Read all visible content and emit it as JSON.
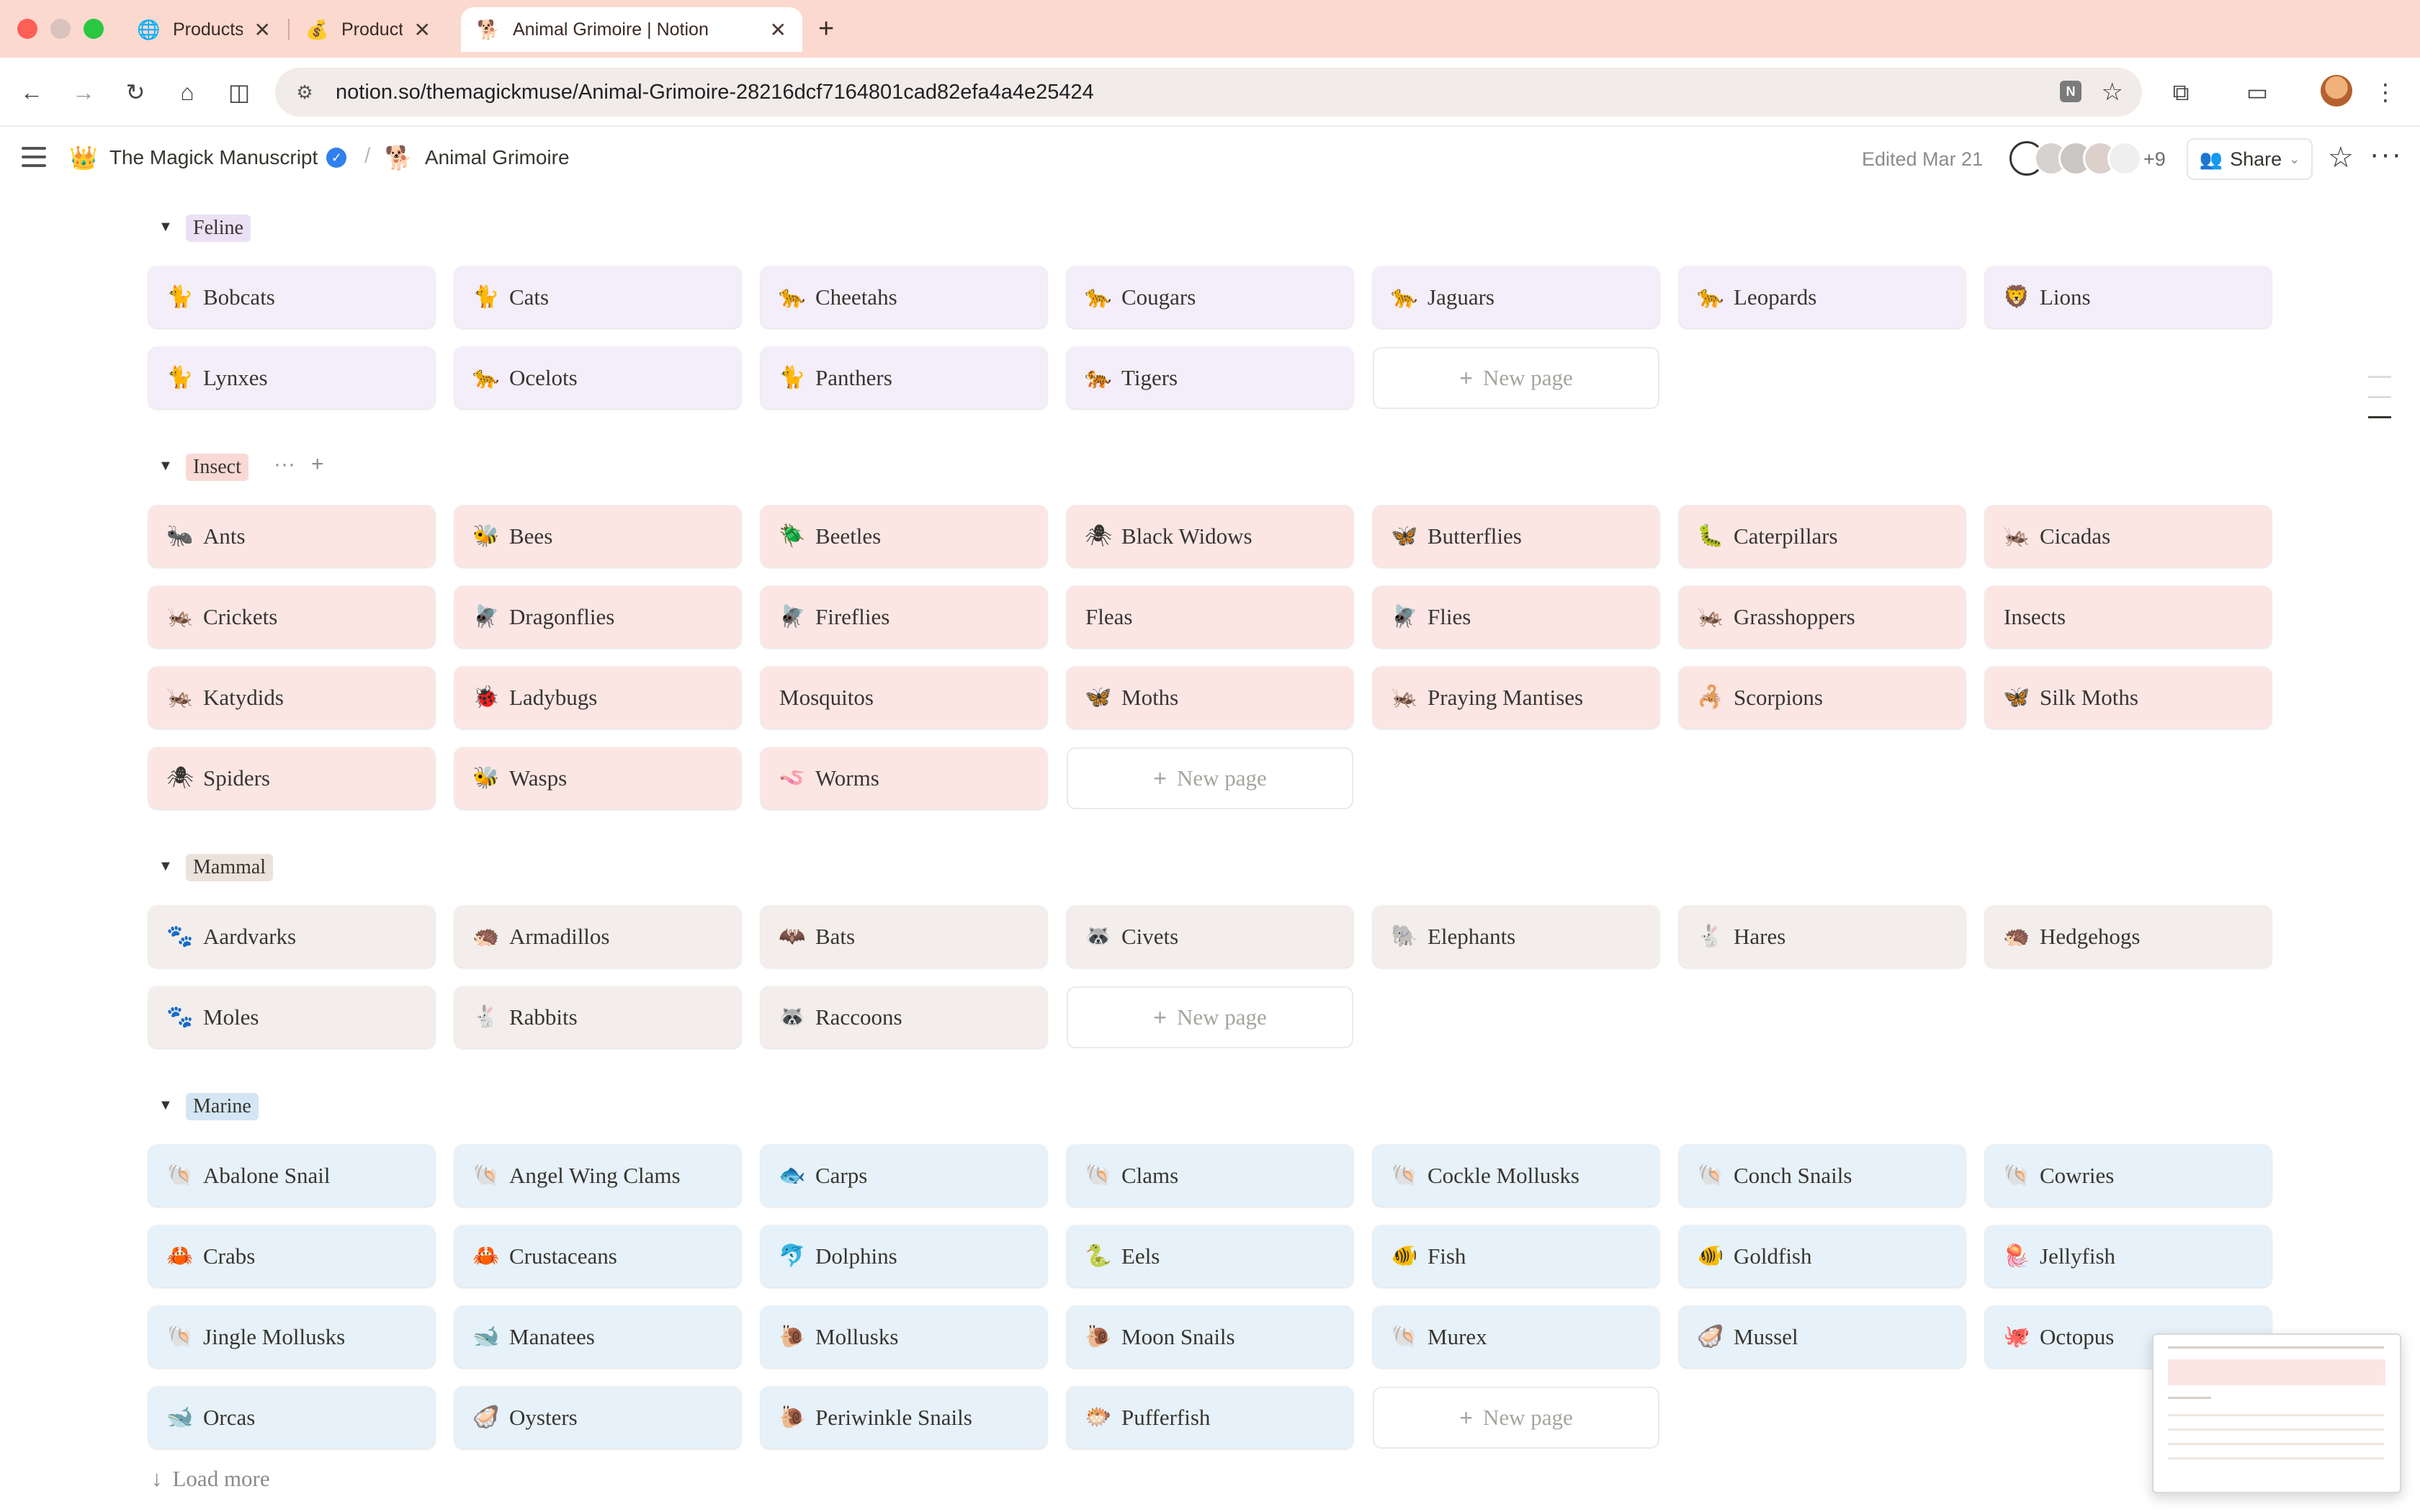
{
  "browser": {
    "tabs": [
      {
        "title": "Products",
        "icon": "globe-icon",
        "glyph": "🌐"
      },
      {
        "title": "Product I",
        "icon": "money-bag-icon",
        "glyph": "💰"
      },
      {
        "title": "Animal Grimoire | Notion",
        "icon": "dog-icon",
        "glyph": "🐕"
      }
    ],
    "url": "notion.so/themagickmuse/Animal-Grimoire-28216dcf7164801cad82efa4a4e25424"
  },
  "topbar": {
    "workspace": "The Magick Manuscript",
    "workspace_glyph": "👑",
    "page": "Animal Grimoire",
    "page_glyph": "🐕",
    "edited": "Edited Mar 21",
    "more_count": "+9",
    "share_label": "Share"
  },
  "groups": {
    "feline": {
      "label": "Feline",
      "cards": [
        {
          "name": "Bobcats",
          "glyph": "🐈"
        },
        {
          "name": "Cats",
          "glyph": "🐈"
        },
        {
          "name": "Cheetahs",
          "glyph": "🐆"
        },
        {
          "name": "Cougars",
          "glyph": "🐆"
        },
        {
          "name": "Jaguars",
          "glyph": "🐆"
        },
        {
          "name": "Leopards",
          "glyph": "🐆"
        },
        {
          "name": "Lions",
          "glyph": "🦁"
        },
        {
          "name": "Lynxes",
          "glyph": "🐈"
        },
        {
          "name": "Ocelots",
          "glyph": "🐆"
        },
        {
          "name": "Panthers",
          "glyph": "🐈"
        },
        {
          "name": "Tigers",
          "glyph": "🐅"
        }
      ]
    },
    "insect": {
      "label": "Insect",
      "cards": [
        {
          "name": "Ants",
          "glyph": "🐜"
        },
        {
          "name": "Bees",
          "glyph": "🐝"
        },
        {
          "name": "Beetles",
          "glyph": "🪲"
        },
        {
          "name": "Black Widows",
          "glyph": "🕷"
        },
        {
          "name": "Butterflies",
          "glyph": "🦋"
        },
        {
          "name": "Caterpillars",
          "glyph": "🐛"
        },
        {
          "name": "Cicadas",
          "glyph": "🦗"
        },
        {
          "name": "Crickets",
          "glyph": "🦗"
        },
        {
          "name": "Dragonflies",
          "glyph": "🪰"
        },
        {
          "name": "Fireflies",
          "glyph": "🪰"
        },
        {
          "name": "Fleas",
          "glyph": ""
        },
        {
          "name": "Flies",
          "glyph": "🪰"
        },
        {
          "name": "Grasshoppers",
          "glyph": "🦗"
        },
        {
          "name": "Insects",
          "glyph": ""
        },
        {
          "name": "Katydids",
          "glyph": "🦗"
        },
        {
          "name": "Ladybugs",
          "glyph": "🐞"
        },
        {
          "name": "Mosquitos",
          "glyph": ""
        },
        {
          "name": "Moths",
          "glyph": "🦋"
        },
        {
          "name": "Praying Mantises",
          "glyph": "🦗"
        },
        {
          "name": "Scorpions",
          "glyph": "🦂"
        },
        {
          "name": "Silk Moths",
          "glyph": "🦋"
        },
        {
          "name": "Spiders",
          "glyph": "🕷"
        },
        {
          "name": "Wasps",
          "glyph": "🐝"
        },
        {
          "name": "Worms",
          "glyph": "🪱"
        }
      ]
    },
    "mammal": {
      "label": "Mammal",
      "cards": [
        {
          "name": "Aardvarks",
          "glyph": "🐾"
        },
        {
          "name": "Armadillos",
          "glyph": "🦔"
        },
        {
          "name": "Bats",
          "glyph": "🦇"
        },
        {
          "name": "Civets",
          "glyph": "🦝"
        },
        {
          "name": "Elephants",
          "glyph": "🐘"
        },
        {
          "name": "Hares",
          "glyph": "🐇"
        },
        {
          "name": "Hedgehogs",
          "glyph": "🦔"
        },
        {
          "name": "Moles",
          "glyph": "🐾"
        },
        {
          "name": "Rabbits",
          "glyph": "🐇"
        },
        {
          "name": "Raccoons",
          "glyph": "🦝"
        }
      ]
    },
    "marine": {
      "label": "Marine",
      "cards": [
        {
          "name": "Abalone Snail",
          "glyph": "🐚"
        },
        {
          "name": "Angel Wing Clams",
          "glyph": "🐚"
        },
        {
          "name": "Carps",
          "glyph": "🐟"
        },
        {
          "name": "Clams",
          "glyph": "🐚"
        },
        {
          "name": "Cockle Mollusks",
          "glyph": "🐚"
        },
        {
          "name": "Conch Snails",
          "glyph": "🐚"
        },
        {
          "name": "Cowries",
          "glyph": "🐚"
        },
        {
          "name": "Crabs",
          "glyph": "🦀"
        },
        {
          "name": "Crustaceans",
          "glyph": "🦀"
        },
        {
          "name": "Dolphins",
          "glyph": "🐬"
        },
        {
          "name": "Eels",
          "glyph": "🐍"
        },
        {
          "name": "Fish",
          "glyph": "🐠"
        },
        {
          "name": "Goldfish",
          "glyph": "🐠"
        },
        {
          "name": "Jellyfish",
          "glyph": "🪼"
        },
        {
          "name": "Jingle Mollusks",
          "glyph": "🐚"
        },
        {
          "name": "Manatees",
          "glyph": "🐋"
        },
        {
          "name": "Mollusks",
          "glyph": "🐌"
        },
        {
          "name": "Moon Snails",
          "glyph": "🐌"
        },
        {
          "name": "Murex",
          "glyph": "🐚"
        },
        {
          "name": "Mussel",
          "glyph": "🦪"
        },
        {
          "name": "Octopus",
          "glyph": "🐙"
        },
        {
          "name": "Orcas",
          "glyph": "🐋"
        },
        {
          "name": "Oysters",
          "glyph": "🦪"
        },
        {
          "name": "Periwinkle Snails",
          "glyph": "🐌"
        },
        {
          "name": "Pufferfish",
          "glyph": "🐡"
        }
      ]
    }
  },
  "new_page_label": "New page",
  "load_more_label": "Load more"
}
